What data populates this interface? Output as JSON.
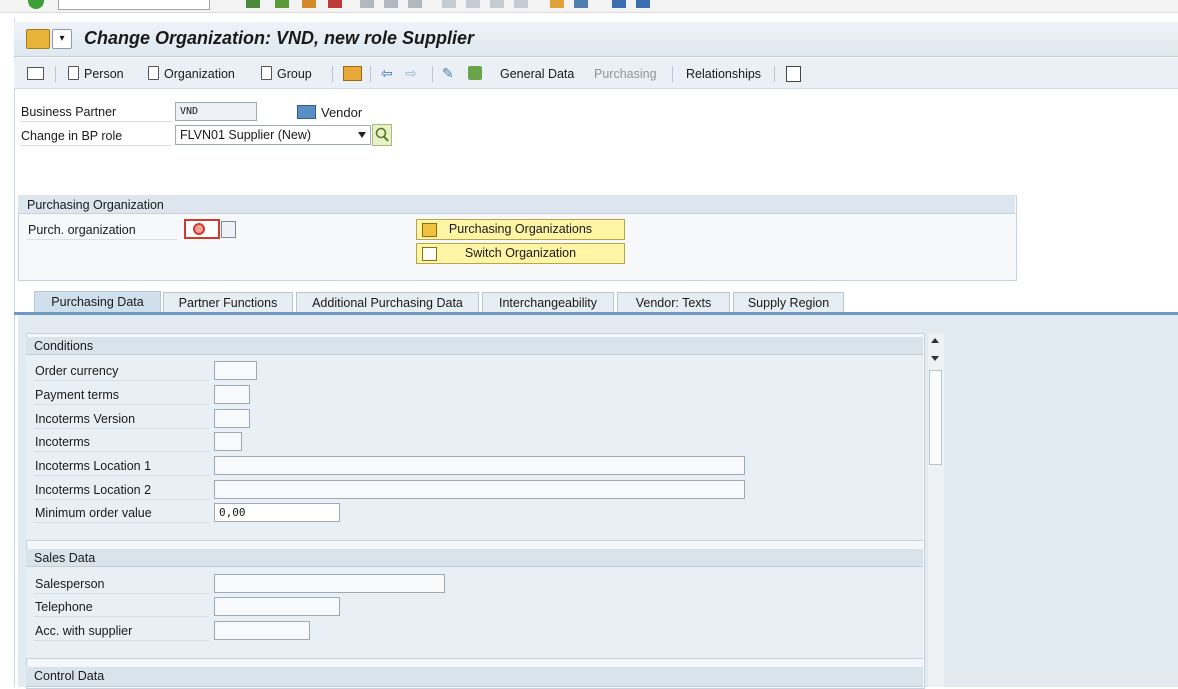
{
  "window": {
    "title": "Change Organization: VND, new role Supplier"
  },
  "toolbar": {
    "person": "Person",
    "organization": "Organization",
    "group": "Group",
    "general_data": "General Data",
    "purchasing": "Purchasing",
    "relationships": "Relationships"
  },
  "header": {
    "bp_label": "Business Partner",
    "bp_value": "VND",
    "bp_type": "Vendor",
    "role_label": "Change in BP role",
    "role_value": "FLVN01 Supplier (New)"
  },
  "porg": {
    "group_title": "Purchasing Organization",
    "label": "Purch. organization",
    "value": "",
    "btn_orgs": "Purchasing Organizations",
    "btn_switch": "Switch Organization"
  },
  "tabs": [
    {
      "label": "Purchasing Data",
      "active": true
    },
    {
      "label": "Partner Functions"
    },
    {
      "label": "Additional Purchasing Data"
    },
    {
      "label": "Interchangeability"
    },
    {
      "label": "Vendor: Texts"
    },
    {
      "label": "Supply Region"
    }
  ],
  "conditions": {
    "title": "Conditions",
    "fields": [
      {
        "label": "Order currency",
        "value": ""
      },
      {
        "label": "Payment terms",
        "value": ""
      },
      {
        "label": "Incoterms Version",
        "value": ""
      },
      {
        "label": "Incoterms",
        "value": ""
      },
      {
        "label": "Incoterms Location 1",
        "value": ""
      },
      {
        "label": "Incoterms Location 2",
        "value": ""
      },
      {
        "label": "Minimum order value",
        "value": "0,00"
      }
    ]
  },
  "sales": {
    "title": "Sales Data",
    "fields": [
      {
        "label": "Salesperson",
        "value": ""
      },
      {
        "label": "Telephone",
        "value": ""
      },
      {
        "label": "Acc. with supplier",
        "value": ""
      }
    ]
  },
  "control": {
    "title": "Control Data"
  },
  "icons": {
    "person": "document-icon",
    "organization": "document-icon",
    "group": "document-icon",
    "vendor": "factory-icon",
    "search": "magnifier-icon"
  }
}
